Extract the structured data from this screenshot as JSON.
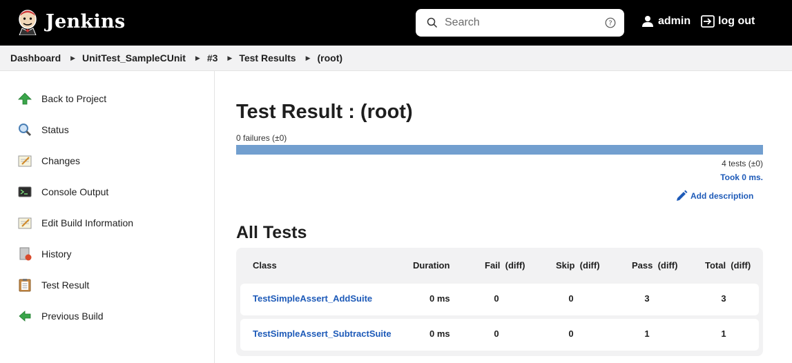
{
  "header": {
    "brand": "Jenkins",
    "search_placeholder": "Search",
    "user": "admin",
    "logout": "log out"
  },
  "breadcrumb": [
    "Dashboard",
    "UnitTest_SampleCUnit",
    "#3",
    "Test Results",
    "(root)"
  ],
  "sidebar": {
    "items": [
      {
        "label": "Back to Project",
        "icon": "up-arrow-icon"
      },
      {
        "label": "Status",
        "icon": "magnifier-icon"
      },
      {
        "label": "Changes",
        "icon": "notepad-icon"
      },
      {
        "label": "Console Output",
        "icon": "terminal-icon"
      },
      {
        "label": "Edit Build Information",
        "icon": "notepad-icon"
      },
      {
        "label": "History",
        "icon": "history-icon"
      },
      {
        "label": "Test Result",
        "icon": "clipboard-icon"
      },
      {
        "label": "Previous Build",
        "icon": "left-arrow-icon"
      }
    ]
  },
  "main": {
    "title": "Test Result : (root)",
    "failures": "0 failures (±0)",
    "pass_fraction": 1.0,
    "tests_summary": "4 tests (±0)",
    "took": "Took 0 ms.",
    "add_description": "Add description",
    "all_tests_title": "All Tests",
    "table": {
      "headers": [
        "Class",
        "Duration",
        "Fail  (diff)",
        "Skip  (diff)",
        "Pass  (diff)",
        "Total  (diff)"
      ],
      "rows": [
        {
          "class": "TestSimpleAssert_AddSuite",
          "duration": "0 ms",
          "fail": "0",
          "skip": "0",
          "pass": "3",
          "total": "3"
        },
        {
          "class": "TestSimpleAssert_SubtractSuite",
          "duration": "0 ms",
          "fail": "0",
          "skip": "0",
          "pass": "1",
          "total": "1"
        }
      ]
    }
  },
  "colors": {
    "header_bg": "#000000",
    "link": "#1d5ab8",
    "progress_pass": "#729fcf",
    "table_bg": "#f2f2f3"
  }
}
